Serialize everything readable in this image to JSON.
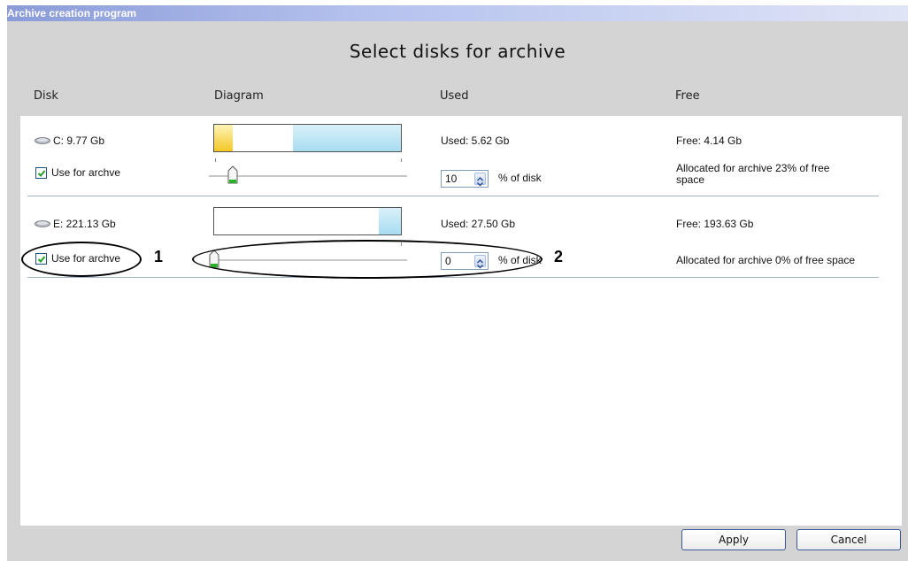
{
  "window": {
    "title": "Archive creation program"
  },
  "heading": "Select disks for archive",
  "columns": {
    "disk": "Disk",
    "diagram": "Diagram",
    "used": "Used",
    "free": "Free"
  },
  "disks": [
    {
      "name": "C:  9.77 Gb",
      "use_label": "Use for archve",
      "use_checked": true,
      "used_text": "Used: 5.62 Gb",
      "free_text": "Free: 4.14 Gb",
      "percent_value": "10",
      "percent_suffix": "% of disk",
      "allocated_text": "Allocated for archive 23% of free space",
      "used_fraction": 0.58,
      "archive_fraction": 0.1,
      "slider_percent": 10
    },
    {
      "name": "E:  221.13 Gb",
      "use_label": "Use for archve",
      "use_checked": true,
      "used_text": "Used: 27.50 Gb",
      "free_text": "Free: 193.63 Gb",
      "percent_value": "0",
      "percent_suffix": "% of disk",
      "allocated_text": "Allocated for archive 0% of free space",
      "used_fraction": 0.12,
      "archive_fraction": 0,
      "slider_percent": 0
    }
  ],
  "callouts": [
    "1",
    "2"
  ],
  "buttons": {
    "apply": "Apply",
    "cancel": "Cancel"
  },
  "colors": {
    "title_bar": "#8a9bd8",
    "used_fill": "#a8dcf1",
    "archive_fill": "#f4c825"
  }
}
